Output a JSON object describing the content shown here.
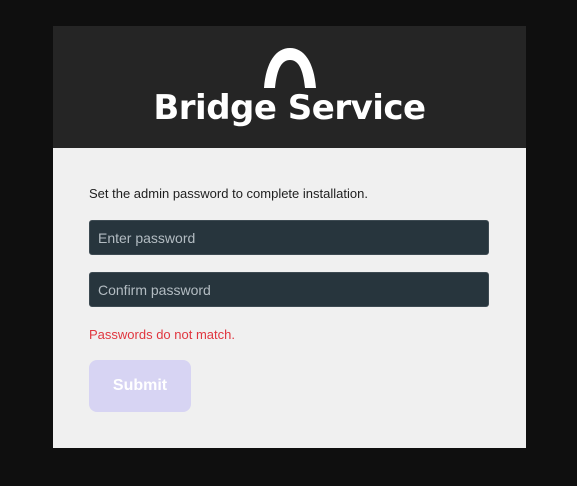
{
  "header": {
    "brand_title": "Bridge Service",
    "logo_icon": "arch-logo-icon"
  },
  "form": {
    "instructions": "Set the admin password to complete installation.",
    "password": {
      "value": "",
      "placeholder": "Enter password"
    },
    "confirm_password": {
      "value": "",
      "placeholder": "Confirm password"
    },
    "error_message": "Passwords do not match.",
    "submit_label": "Submit",
    "submit_disabled": true
  },
  "colors": {
    "page_background": "#0f0f0f",
    "header_background": "#252525",
    "body_background": "#f0f0f0",
    "input_background": "#27353d",
    "error": "#e0363f",
    "submit_disabled": "#d7d4f3"
  }
}
